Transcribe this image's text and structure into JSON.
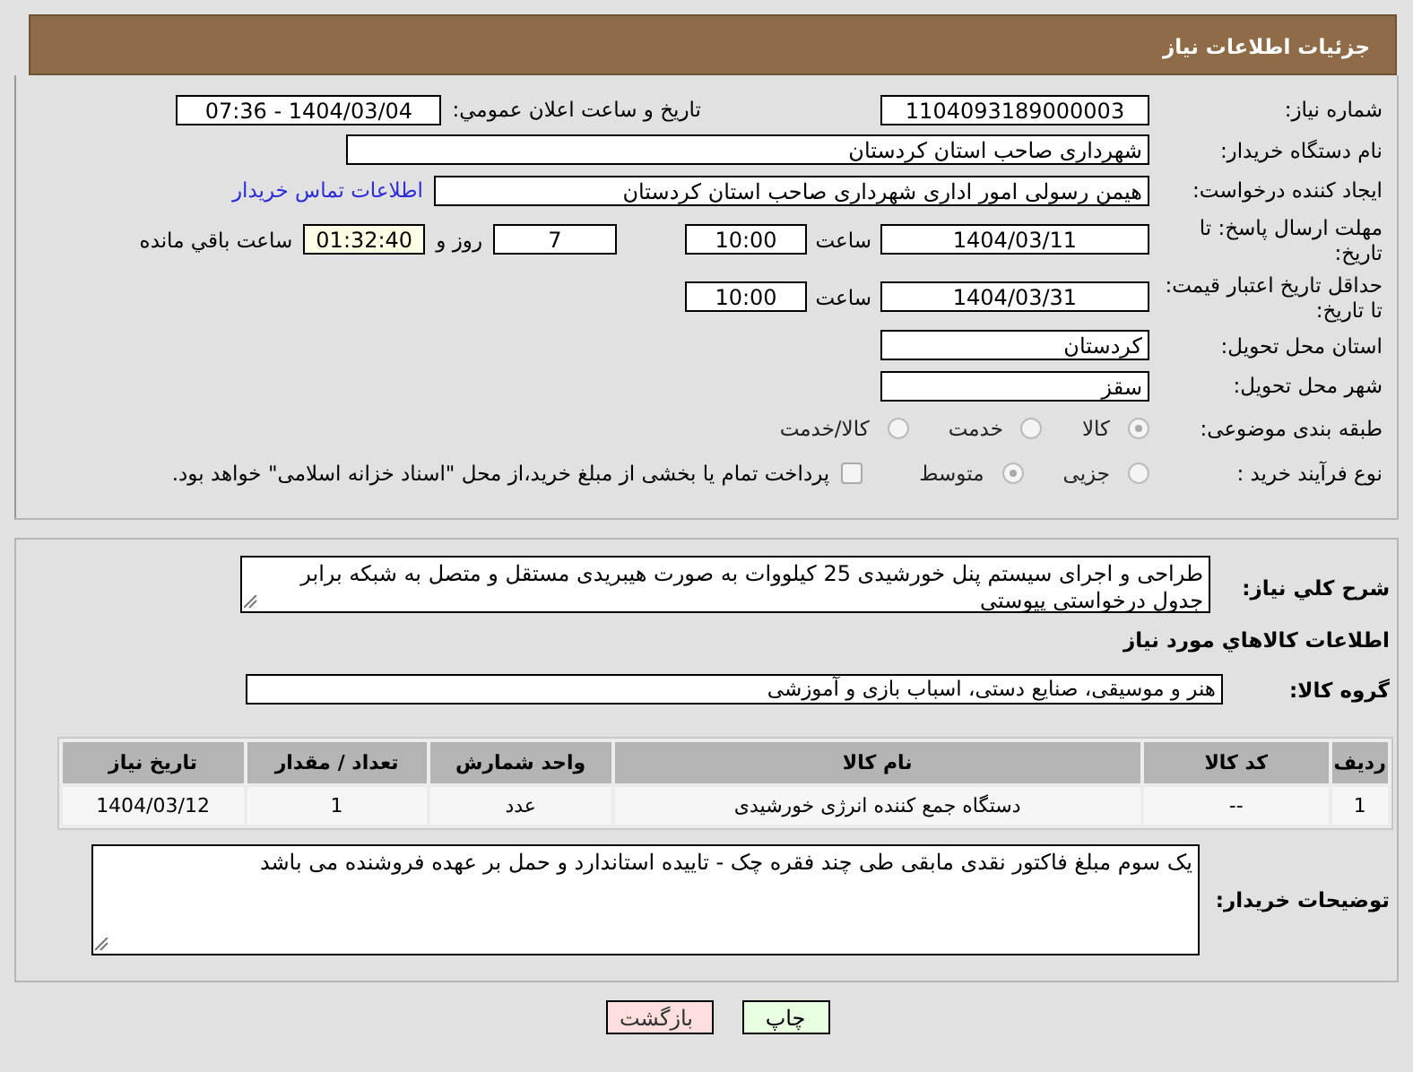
{
  "header": {
    "title": "جزئیات اطلاعات نیاز"
  },
  "need_number": {
    "label": "شماره نیاز:",
    "value": "1104093189000003"
  },
  "announce": {
    "label": "تاریخ و ساعت اعلان عمومي:",
    "value": "1404/03/04 - 07:36"
  },
  "buyer_org": {
    "label": "نام دستگاه خریدار:",
    "value": "شهرداری صاحب استان کردستان"
  },
  "creator": {
    "label": "ایجاد کننده درخواست:",
    "value": "هیمن رسولی امور اداری شهرداری صاحب استان کردستان",
    "link": "اطلاعات تماس خریدار"
  },
  "reply_deadline": {
    "label": "مهلت ارسال پاسخ: تا تاریخ:",
    "date": "1404/03/11",
    "time_label": "ساعت",
    "time": "10:00",
    "days": "7",
    "days_label": "روز و",
    "remaining": "01:32:40",
    "remaining_label": "ساعت باقي مانده"
  },
  "price_validity": {
    "label": "حداقل تاریخ اعتبار قیمت: تا تاریخ:",
    "date": "1404/03/31",
    "time_label": "ساعت",
    "time": "10:00"
  },
  "province": {
    "label": "استان محل تحویل:",
    "value": "کردستان"
  },
  "city": {
    "label": "شهر محل تحویل:",
    "value": "سقز"
  },
  "category": {
    "label": "طبقه بندی موضوعی:",
    "options": [
      {
        "label": "کالا",
        "selected": true
      },
      {
        "label": "خدمت",
        "selected": false
      },
      {
        "label": "کالا/خدمت",
        "selected": false
      }
    ]
  },
  "purchase_type": {
    "label": "نوع فرآیند خرید :",
    "options": [
      {
        "label": "جزیی",
        "selected": false
      },
      {
        "label": "متوسط",
        "selected": true
      }
    ],
    "payment": {
      "checked": false,
      "text": "پرداخت تمام یا بخشی از مبلغ خرید،از محل \"اسناد خزانه اسلامی\" خواهد بود."
    }
  },
  "description": {
    "label": "شرح کلي نیاز:",
    "value": "طراحی و اجرای سیستم پنل خورشیدی 25 کیلووات به صورت هیبریدی مستقل و متصل به شبکه برابر جدول درخواستی پیوستی"
  },
  "goods_heading": "اطلاعات کالاهاي مورد نیاز",
  "goods_group": {
    "label": "گروه کالا:",
    "value": "هنر و موسیقی، صنایع دستی، اسباب بازی و آموزشی"
  },
  "table": {
    "columns": [
      "ردیف",
      "کد کالا",
      "نام کالا",
      "واحد شمارش",
      "تعداد / مقدار",
      "تاریخ نیاز"
    ],
    "rows": [
      [
        "1",
        "--",
        "دستگاه جمع کننده انرژی خورشیدی",
        "عدد",
        "1",
        "1404/03/12"
      ]
    ]
  },
  "notes": {
    "label": "توضیحات خریدار:",
    "value": "یک سوم مبلغ فاکتور نقدی مابقی طی چند فقره چک - تاییده استاندارد و حمل بر عهده فروشنده می باشد"
  },
  "buttons": [
    {
      "label": "چاپ",
      "kind": "print"
    },
    {
      "label": "بازگشت",
      "kind": "back"
    }
  ]
}
